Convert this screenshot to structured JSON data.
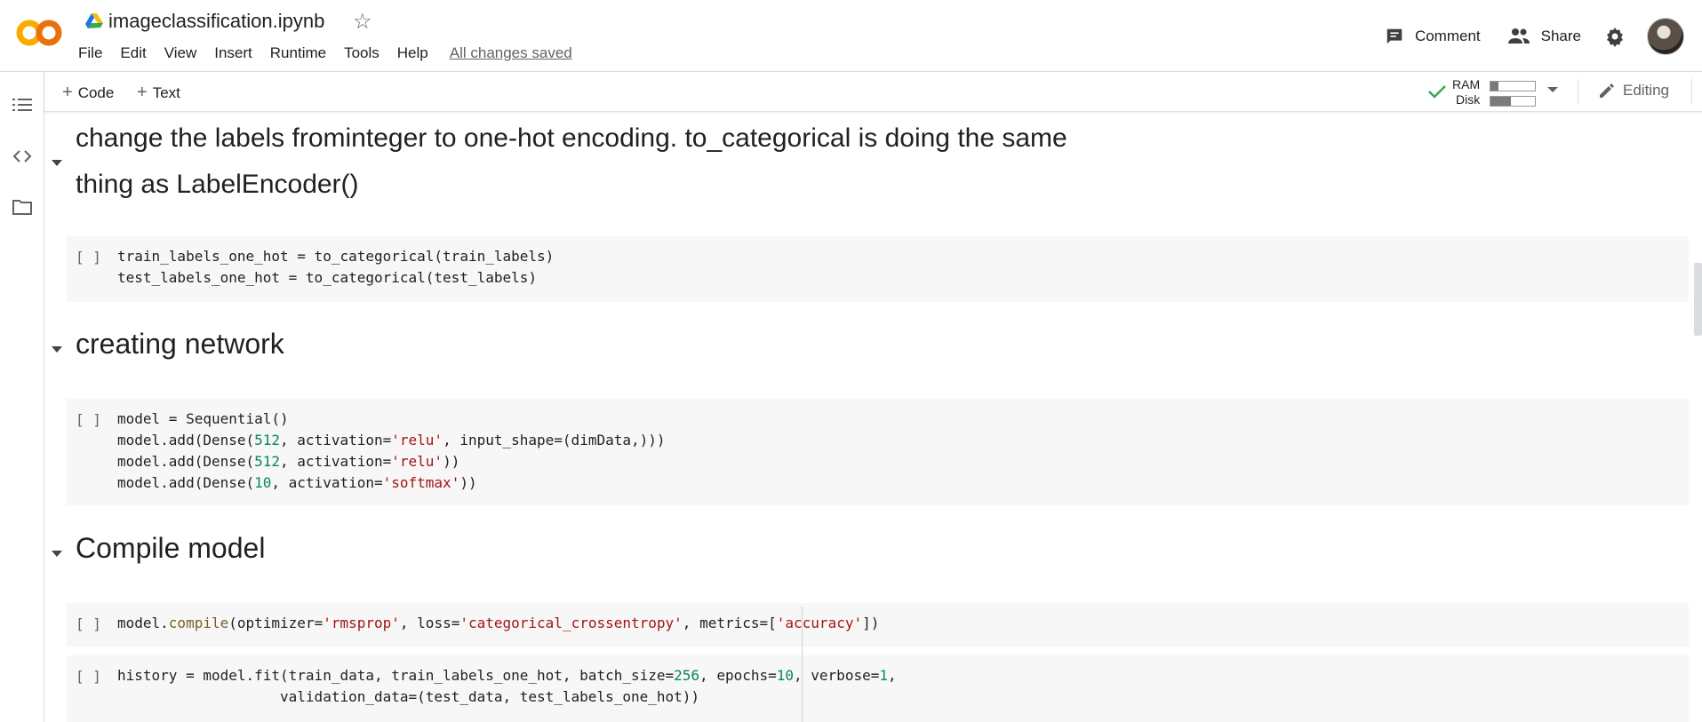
{
  "app": {
    "notebook_title": "imageclassification.ipynb",
    "menu": [
      "File",
      "Edit",
      "View",
      "Insert",
      "Runtime",
      "Tools",
      "Help"
    ],
    "save_status": "All changes saved",
    "comment_label": "Comment",
    "share_label": "Share"
  },
  "toolbar": {
    "add_code_label": "Code",
    "add_text_label": "Text",
    "ram_label": "RAM",
    "disk_label": "Disk",
    "ram_usage": 0.18,
    "disk_usage": 0.45,
    "editing_label": "Editing"
  },
  "cells": {
    "heading1_line1": "change the labels frominteger to one-hot encoding. to_categorical is doing the same",
    "heading1_line2": "thing as LabelEncoder()",
    "run_label": "[ ]",
    "code1_line1": "train_labels_one_hot = to_categorical(train_labels)",
    "code1_line2": "test_labels_one_hot = to_categorical(test_labels)",
    "heading2": "creating network",
    "code2_l1": "model = Sequential()",
    "code2_l2a": "model.add(Dense(",
    "code2_l2b": "512",
    "code2_l2c": ", activation=",
    "code2_l2d": "'relu'",
    "code2_l2e": ", input_shape=(dimData,)))",
    "code2_l3a": "model.add(Dense(",
    "code2_l3b": "512",
    "code2_l3c": ", activation=",
    "code2_l3d": "'relu'",
    "code2_l3e": "))",
    "code2_l4a": "model.add(Dense(",
    "code2_l4b": "10",
    "code2_l4c": ", activation=",
    "code2_l4d": "'softmax'",
    "code2_l4e": "))",
    "heading3": "Compile model",
    "code3_a": "model.",
    "code3_b": "compile",
    "code3_c": "(optimizer=",
    "code3_d": "'rmsprop'",
    "code3_e": ", loss=",
    "code3_f": "'categorical_crossentropy'",
    "code3_g": ", metrics=[",
    "code3_h": "'accuracy'",
    "code3_i": "])",
    "code4_a": "history = model.fit(train_data, train_labels_one_hot, batch_size=",
    "code4_b": "256",
    "code4_c": ", epochs=",
    "code4_d": "10",
    "code4_e": ", verbose=",
    "code4_f": "1",
    "code4_g": ",",
    "code4_l2": "                   validation_data=(test_data, test_labels_one_hot))"
  },
  "colors": {
    "string": "#a31515",
    "number": "#098658",
    "function": "#795e26",
    "cell_bg": "#f7f7f7",
    "check": "#34a853"
  },
  "icons": [
    "colab-logo",
    "drive-icon",
    "star-icon",
    "comment-icon",
    "share-people-icon",
    "gear-icon",
    "toc-icon",
    "code-snippets-icon",
    "folder-icon",
    "check-icon",
    "dropdown-icon",
    "pencil-icon",
    "chevron-up-icon",
    "collapse-caret-icon"
  ]
}
